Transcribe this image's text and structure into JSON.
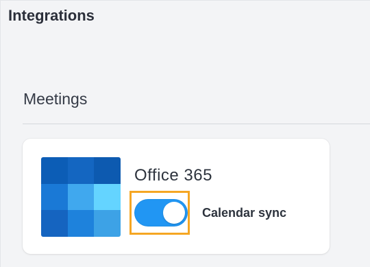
{
  "page": {
    "title": "Integrations"
  },
  "section": {
    "title": "Meetings"
  },
  "integration": {
    "name": "Office 365",
    "logo_icon": "office-365-calendar-logo-icon",
    "logo_colors": [
      "#0c5db6",
      "#1466c1",
      "#0d5ab0",
      "#1a79d6",
      "#40a8ee",
      "#64d4ff",
      "#1564c0",
      "#1e82dc",
      "#3da2e6",
      "#0b3f88",
      "#1460b8",
      "#1b77d2"
    ],
    "toggle": {
      "label": "Calendar sync",
      "enabled": true,
      "on_color": "#2196f3",
      "highlight_color": "#f5a623"
    }
  }
}
